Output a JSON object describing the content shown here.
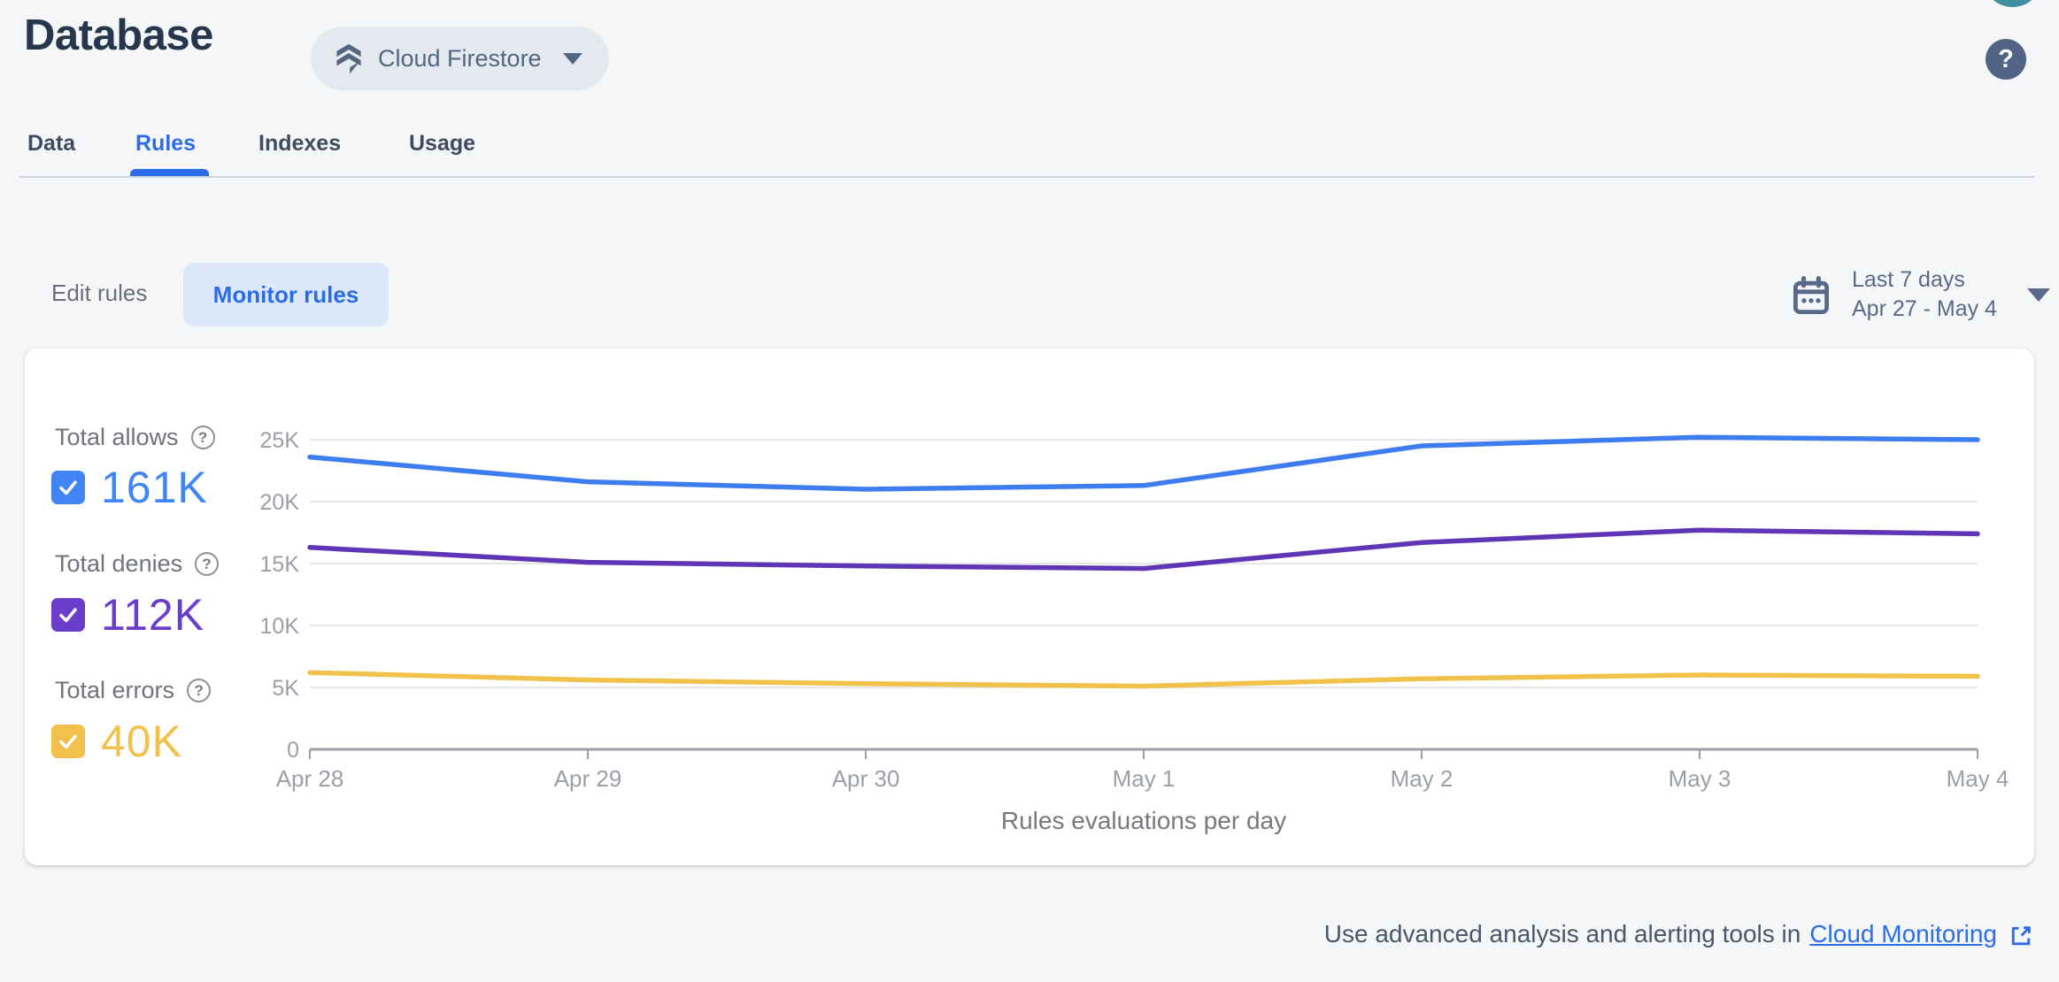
{
  "header": {
    "title": "Database",
    "database_selector": {
      "label": "Cloud Firestore"
    },
    "help_label": "?"
  },
  "tabs": [
    {
      "label": "Data",
      "active": false
    },
    {
      "label": "Rules",
      "active": true
    },
    {
      "label": "Indexes",
      "active": false
    },
    {
      "label": "Usage",
      "active": false
    }
  ],
  "toolbar": {
    "edit_rules_label": "Edit rules",
    "monitor_rules_label": "Monitor rules",
    "date_range": {
      "label": "Last 7 days",
      "range": "Apr 27 - May 4"
    }
  },
  "legend": [
    {
      "label": "Total allows",
      "value": "161K",
      "color": "#4184f3",
      "checked": true
    },
    {
      "label": "Total denies",
      "value": "112K",
      "color": "#6a3ecb",
      "checked": true
    },
    {
      "label": "Total errors",
      "value": "40K",
      "color": "#f2c14c",
      "checked": true
    }
  ],
  "chart_data": {
    "type": "line",
    "title": "Rules evaluations per day",
    "categories": [
      "Apr 28",
      "Apr 29",
      "Apr 30",
      "May 1",
      "May 2",
      "May 3",
      "May 4"
    ],
    "series": [
      {
        "name": "Total allows",
        "color": "#3e7df0",
        "values": [
          23600,
          21600,
          21000,
          21300,
          24500,
          25200,
          25000
        ]
      },
      {
        "name": "Total denies",
        "color": "#5d35b5",
        "values": [
          16300,
          15100,
          14800,
          14600,
          16700,
          17700,
          17400
        ]
      },
      {
        "name": "Total errors",
        "color": "#f0c14b",
        "values": [
          6200,
          5600,
          5300,
          5100,
          5700,
          6000,
          5900
        ]
      }
    ],
    "ylim": [
      0,
      25000
    ],
    "yticks": [
      {
        "value": 0,
        "label": "0"
      },
      {
        "value": 5000,
        "label": "5K"
      },
      {
        "value": 10000,
        "label": "10K"
      },
      {
        "value": 15000,
        "label": "15K"
      },
      {
        "value": 20000,
        "label": "20K"
      },
      {
        "value": 25000,
        "label": "25K"
      }
    ],
    "grid": true,
    "legend_position": "left"
  },
  "footer": {
    "text": "Use advanced analysis and alerting tools in",
    "link_label": "Cloud Monitoring"
  }
}
